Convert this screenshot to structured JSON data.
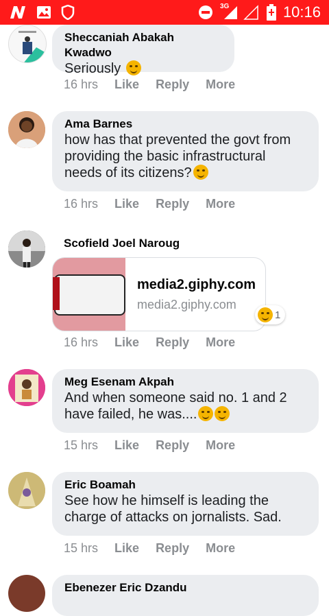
{
  "status_bar": {
    "time": "10:16",
    "network": "3G",
    "color": "#ff1a1a"
  },
  "comments": [
    {
      "author": "Sheccaniah Abakah Kwadwo",
      "text": "Seriously",
      "emoji": "laughing-emoji",
      "time": "16 hrs",
      "like": "Like",
      "reply": "Reply",
      "more": "More"
    },
    {
      "author": "Ama Barnes",
      "text": "how has that prevented the govt from providing the basic infrastructural needs of its citizens?",
      "emoji": "thinking-emoji",
      "time": "16 hrs",
      "like": "Like",
      "reply": "Reply",
      "more": "More"
    },
    {
      "author": "Scofield Joel Naroug",
      "link_title": "media2.giphy.com",
      "link_sub": "media2.giphy.com",
      "reaction_count": "1",
      "time": "16 hrs",
      "like": "Like",
      "reply": "Reply",
      "more": "More"
    },
    {
      "author": "Meg Esenam Akpah",
      "text": "And when someone said no. 1 and 2 have failed, he was....",
      "emoji": "smirk-emoji",
      "time": "15 hrs",
      "like": "Like",
      "reply": "Reply",
      "more": "More"
    },
    {
      "author": "Eric Boamah",
      "text": "See how he himself is leading the charge of attacks on jornalists. Sad.",
      "time": "15 hrs",
      "like": "Like",
      "reply": "Reply",
      "more": "More"
    },
    {
      "author": "Ebenezer Eric Dzandu"
    }
  ]
}
